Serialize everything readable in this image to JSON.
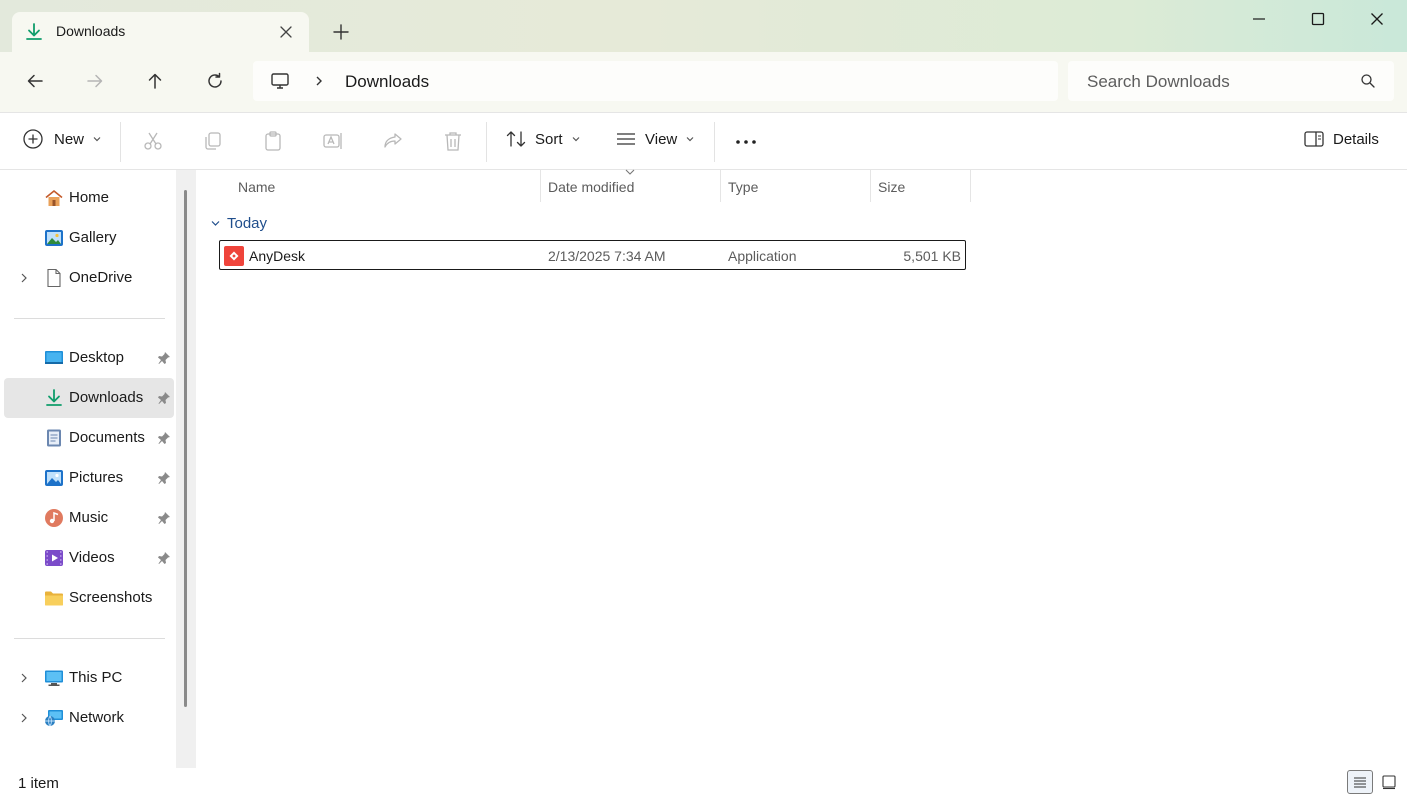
{
  "window": {
    "tab_title": "Downloads",
    "accent_color": "#0f9d6b"
  },
  "address": {
    "location": "Downloads"
  },
  "search": {
    "placeholder": "Search Downloads"
  },
  "toolbar": {
    "new_label": "New",
    "sort_label": "Sort",
    "view_label": "View",
    "details_label": "Details"
  },
  "sidebar": {
    "items": [
      {
        "label": "Home",
        "icon": "home-icon"
      },
      {
        "label": "Gallery",
        "icon": "gallery-icon"
      },
      {
        "label": "OneDrive",
        "icon": "file-icon"
      },
      {
        "label": "Desktop",
        "icon": "desktop-icon"
      },
      {
        "label": "Downloads",
        "icon": "download-icon"
      },
      {
        "label": "Documents",
        "icon": "documents-icon"
      },
      {
        "label": "Pictures",
        "icon": "pictures-icon"
      },
      {
        "label": "Music",
        "icon": "music-icon"
      },
      {
        "label": "Videos",
        "icon": "videos-icon"
      },
      {
        "label": "Screenshots",
        "icon": "folder-icon"
      },
      {
        "label": "This PC",
        "icon": "this-pc-icon"
      },
      {
        "label": "Network",
        "icon": "network-icon"
      }
    ]
  },
  "columns": {
    "name": "Name",
    "date": "Date modified",
    "type": "Type",
    "size": "Size"
  },
  "groups": [
    {
      "label": "Today",
      "files": [
        {
          "name": "AnyDesk",
          "date": "2/13/2025 7:34 AM",
          "type": "Application",
          "size": "5,501 KB",
          "icon": "anydesk-icon",
          "icon_color": "#ef443b"
        }
      ]
    }
  ],
  "status": {
    "item_count": "1 item"
  }
}
